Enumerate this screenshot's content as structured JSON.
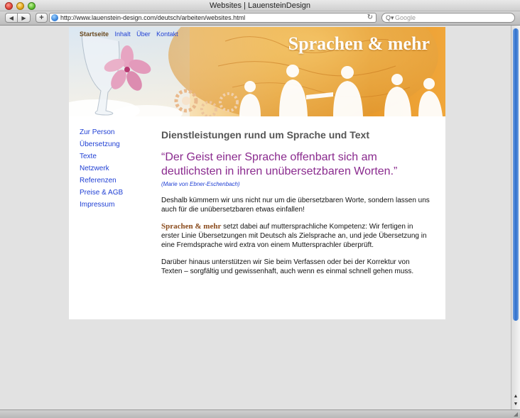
{
  "window": {
    "title": "Websites | LauensteinDesign"
  },
  "toolbar": {
    "back_glyph": "◀",
    "forward_glyph": "▶",
    "add_glyph": "+",
    "url": "http://www.lauenstein-design.com/deutsch/arbeiten/websites.html",
    "reload_glyph": "↻",
    "search_placeholder": "Google",
    "search_glyph": "Q▾"
  },
  "scrollbar": {
    "up_glyph": "▲",
    "down_glyph": "▼"
  },
  "banner": {
    "title": "Sprachen & mehr"
  },
  "topnav": [
    {
      "label": "Startseite"
    },
    {
      "label": "Inhalt"
    },
    {
      "label": "Über"
    },
    {
      "label": "Kontakt"
    }
  ],
  "sidenav": [
    {
      "label": "Zur Person"
    },
    {
      "label": "Übersetzung"
    },
    {
      "label": "Texte"
    },
    {
      "label": "Netzwerk"
    },
    {
      "label": "Referenzen"
    },
    {
      "label": "Preise & AGB"
    },
    {
      "label": "Impressum"
    }
  ],
  "content": {
    "heading": "Dienstleistungen rund um Sprache und Text",
    "quote": "“Der Geist einer Sprache offenbart sich am deutlichsten in ihren unübersetzbaren Worten.”",
    "author": "(Marie von Ebner-Eschenbach)",
    "paragraph1": "Deshalb kümmern wir uns nicht nur um die übersetzbaren Worte, sondern lassen uns auch für die unübersetzbaren etwas einfallen!",
    "brand": "Sprachen & mehr",
    "paragraph2_rest": " setzt dabei auf muttersprachliche Kompetenz: Wir fertigen in erster Linie Übersetzungen mit Deutsch als Zielsprache an, und jede Übersetzung in eine Fremdsprache wird extra von einem Muttersprachler überprüft.",
    "paragraph3": "Darüber hinaus unterstützen wir Sie beim Verfassen oder bei der Korrektur von Texten – sorgfältig und gewissenhaft, auch wenn es einmal schnell gehen muss."
  },
  "colors": {
    "link": "#1f3fd4",
    "quote": "#8a2a8e",
    "brand": "#8a4b1c",
    "heading": "#555555"
  }
}
